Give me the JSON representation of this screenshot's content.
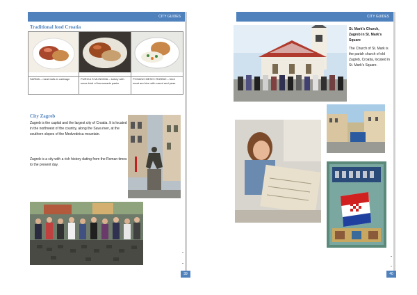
{
  "header": {
    "left": "CITY GUIDES",
    "right": "CITY GUIDES"
  },
  "food": {
    "title": "Traditional food Croatia",
    "items": [
      {
        "caption": "SARMA – meat balls in cabbage"
      },
      {
        "caption": "PURICA S MLINCIMA – turkey with some kind of homemade pasta"
      },
      {
        "caption": "POHANO MESO I RIZIBIZI – fried meat and rice with carrot and peas"
      }
    ]
  },
  "zagreb": {
    "title": "City Zagreb",
    "p1": "Zagreb is the capital and the largest city of Croatia. It is located in the northwest of the country, along the Sava river, at the southern slopes of the Medvednica mountain.",
    "p2": "Zagreb is a city with a rich history dating from the Roman times to the present day."
  },
  "church": {
    "title": "St. Mark's Church, Zagreb in St. Mark's Square",
    "text": "The Church of St. Mark is the parish church of old Zagreb, Croatia, located in St. Mark's Square."
  },
  "pages": {
    "left": "39",
    "right": "40"
  },
  "colors": {
    "accent": "#4f81bd"
  }
}
